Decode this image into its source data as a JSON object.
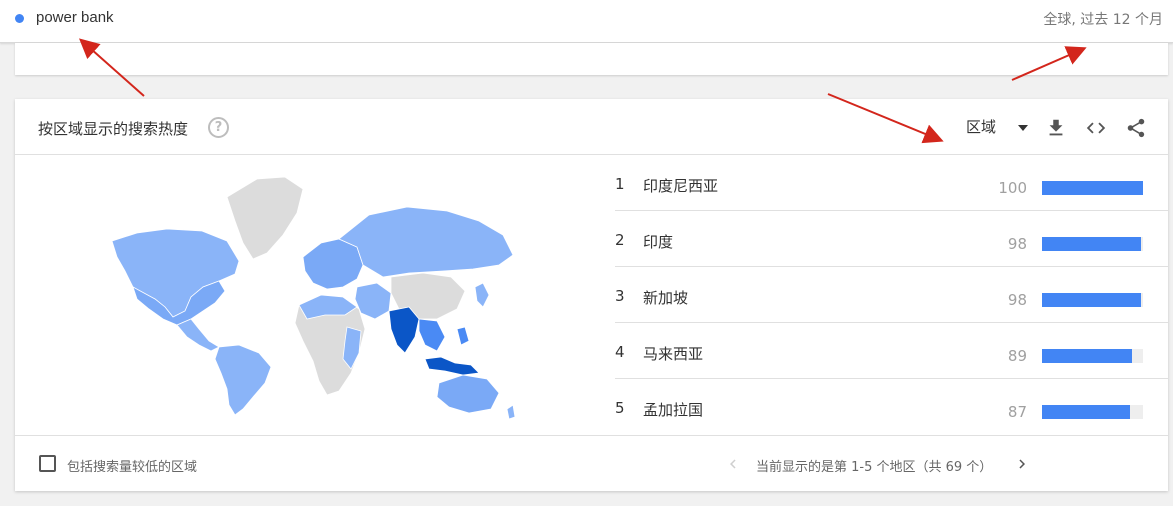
{
  "topbar": {
    "term": "power bank",
    "scope": "全球, 过去 12 个月"
  },
  "card": {
    "title": "按区域显示的搜索热度",
    "help_icon_glyph": "?",
    "region_select": "区域"
  },
  "rankings": [
    {
      "rank": "1",
      "name": "印度尼西亚",
      "value": "100",
      "level": 100
    },
    {
      "rank": "2",
      "name": "印度",
      "value": "98",
      "level": 98
    },
    {
      "rank": "3",
      "name": "新加坡",
      "value": "98",
      "level": 98
    },
    {
      "rank": "4",
      "name": "马来西亚",
      "value": "89",
      "level": 89
    },
    {
      "rank": "5",
      "name": "孟加拉国",
      "value": "87",
      "level": 87
    }
  ],
  "footer": {
    "checkbox_label": "包括搜索量较低的区域",
    "pagination_text": "当前显示的是第 1-5 个地区（共 69 个）"
  },
  "colors": {
    "accent": "#4285f4",
    "map_light": "#8ab4f8",
    "map_mid": "#4a8af4",
    "map_dark": "#0b56c7",
    "map_nodata": "#dcdcdc",
    "annotation": "#d3261c"
  },
  "icons": [
    "dot-icon",
    "help-icon",
    "caret-down-icon",
    "download-icon",
    "embed-code-icon",
    "share-icon",
    "chevron-left-icon",
    "chevron-right-icon"
  ]
}
